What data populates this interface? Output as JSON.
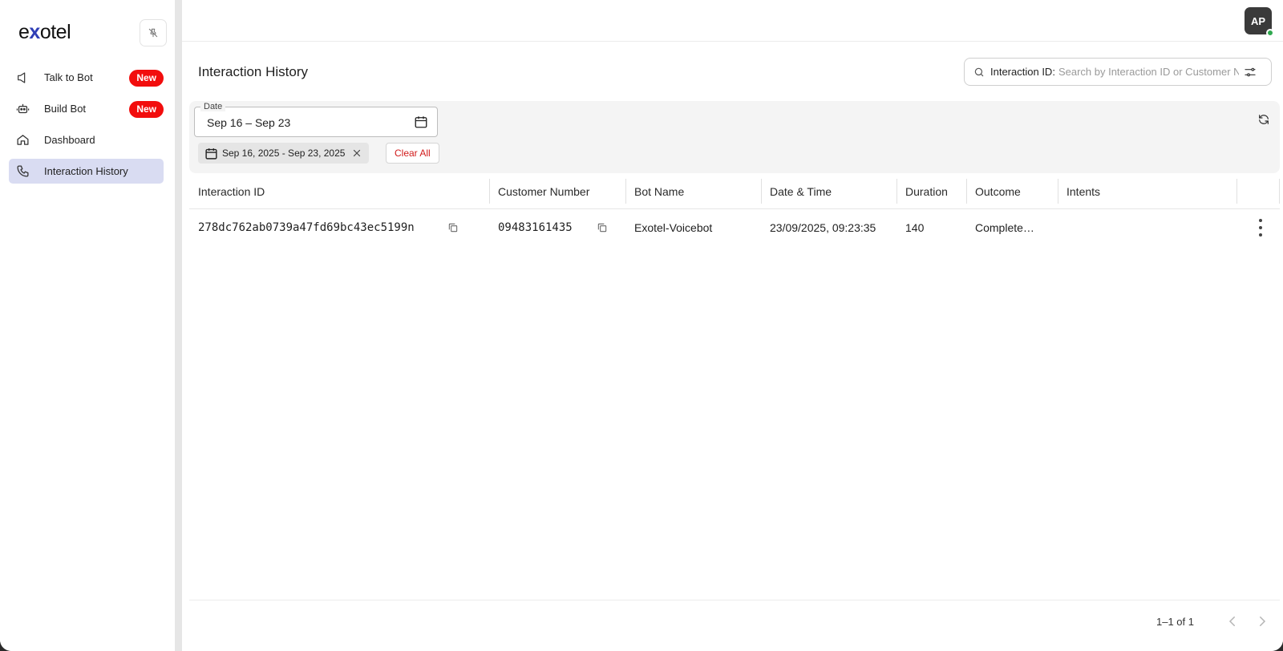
{
  "app": {
    "logo_pre": "e",
    "logo_x": "x",
    "logo_post": "otel"
  },
  "sidebar": {
    "items": [
      {
        "label": "Talk to Bot",
        "badge": "New",
        "icon": "speaker-icon"
      },
      {
        "label": "Build Bot",
        "badge": "New",
        "icon": "robot-icon"
      },
      {
        "label": "Dashboard",
        "icon": "home-icon"
      },
      {
        "label": "Interaction History",
        "icon": "phone-icon",
        "active": true
      }
    ]
  },
  "user": {
    "initials": "AP",
    "status_color": "#2fa84f"
  },
  "page": {
    "title": "Interaction History"
  },
  "search": {
    "label": "Interaction ID:",
    "placeholder": "Search by Interaction ID or Customer Number"
  },
  "filters": {
    "date_label": "Date",
    "date_value": "Sep 16 – Sep 23",
    "chip_text": "Sep 16, 2025 - Sep 23, 2025",
    "clear_all": "Clear All"
  },
  "table": {
    "columns": [
      "Interaction ID",
      "Customer Number",
      "Bot Name",
      "Date & Time",
      "Duration",
      "Outcome",
      "Intents"
    ],
    "rows": [
      {
        "interaction_id": "278dc762ab0739a47fd69bc43ec5199n",
        "customer_number": "09483161435",
        "bot_name": "Exotel-Voicebot",
        "date_time": "23/09/2025, 09:23:35",
        "duration": "140",
        "outcome": "Complete…",
        "intents": ""
      }
    ]
  },
  "pagination": {
    "text": "1–1 of 1"
  },
  "colors": {
    "accent": "#2f3eb6",
    "badge": "#f20d0d",
    "active_nav": "#d9dcf2",
    "danger": "#d11a1a"
  }
}
